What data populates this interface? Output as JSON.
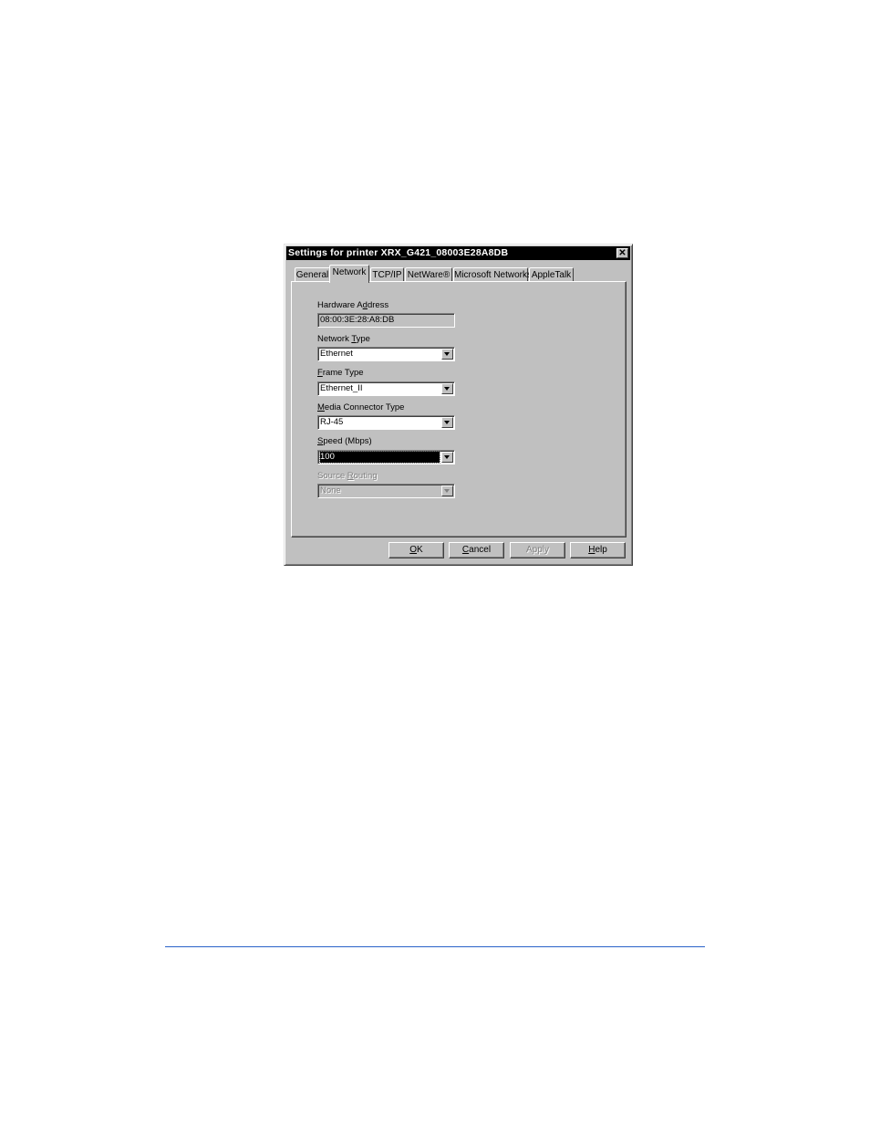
{
  "dialog": {
    "title": "Settings for printer XRX_G421_08003E28A8DB",
    "close_icon": "close-x-icon"
  },
  "tabs": [
    {
      "label": "General",
      "active": false
    },
    {
      "label": "Network",
      "active": true
    },
    {
      "label": "TCP/IP",
      "active": false
    },
    {
      "label": "NetWare®",
      "active": false
    },
    {
      "label": "Microsoft Networks",
      "active": false
    },
    {
      "label": "AppleTalk",
      "active": false
    }
  ],
  "fields": {
    "hardware_address": {
      "label_pre": "Hardware A",
      "label_u": "d",
      "label_post": "dress",
      "value": "08:00:3E:28:A8:DB"
    },
    "network_type": {
      "label_pre": "Network ",
      "label_u": "T",
      "label_post": "ype",
      "value": "Ethernet"
    },
    "frame_type": {
      "label_pre": "",
      "label_u": "F",
      "label_post": "rame Type",
      "value": "Ethernet_II"
    },
    "media_connector_type": {
      "label_pre": "",
      "label_u": "M",
      "label_post": "edia Connector Type",
      "value": "RJ-45"
    },
    "speed": {
      "label_pre": "",
      "label_u": "S",
      "label_post": "peed (Mbps)",
      "value": "100"
    },
    "source_routing": {
      "label_pre": "Source ",
      "label_u": "R",
      "label_post": "outing",
      "value": "None",
      "disabled": true
    }
  },
  "buttons": {
    "ok": {
      "label_u": "O",
      "label_post": "K"
    },
    "cancel": {
      "label_u": "C",
      "label_post": "ancel"
    },
    "apply": {
      "label_u": "",
      "label_post": "Apply",
      "disabled": true
    },
    "help": {
      "label_u": "H",
      "label_post": "elp"
    }
  },
  "colors": {
    "titlebar": "#000000",
    "dialog_face": "#c0c0c0",
    "rule": "#2a62c9"
  }
}
